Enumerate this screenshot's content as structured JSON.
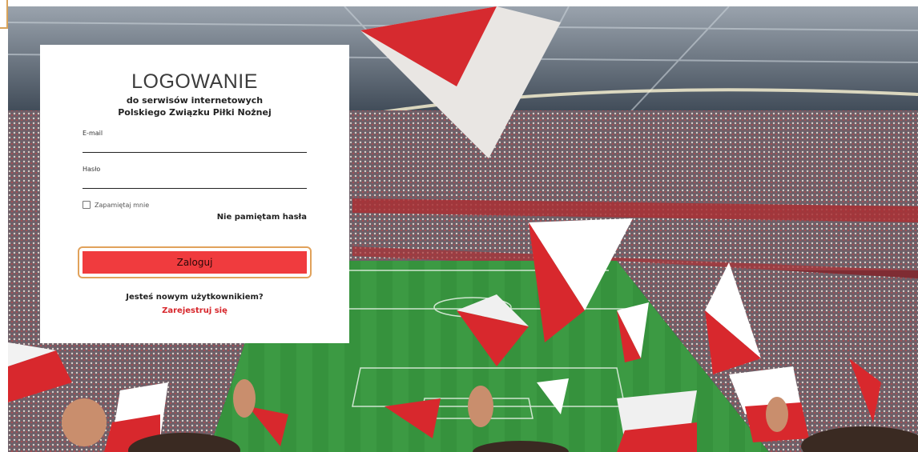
{
  "login": {
    "title": "LOGOWANIE",
    "subtitle_line1": "do serwisów internetowych",
    "subtitle_line2": "Polskiego Związku Piłki Nożnej",
    "email_label": "E-mail",
    "email_value": "",
    "password_label": "Hasło",
    "password_value": "",
    "remember_label": "Zapamiętaj mnie",
    "remember_checked": false,
    "forgot_label": "Nie pamiętam hasła",
    "submit_label": "Zaloguj",
    "new_user_text": "Jesteś nowym użytkownikiem?",
    "register_label": "Zarejestruj się"
  },
  "colors": {
    "accent_red": "#f03b3e",
    "focus_outline": "#e1a25b",
    "register_link": "#d7262b"
  },
  "background": {
    "description_icon": "stadium-photo"
  }
}
